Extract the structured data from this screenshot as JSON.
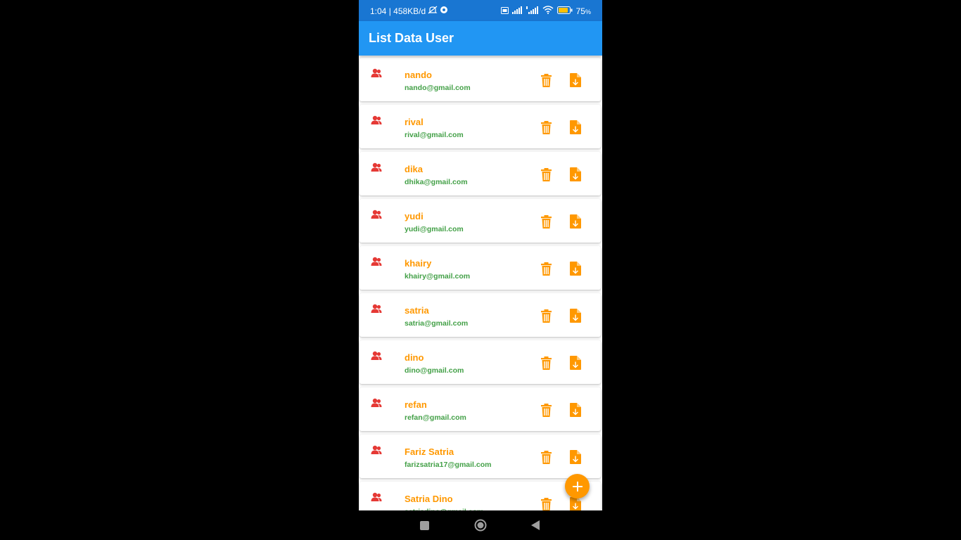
{
  "status_bar": {
    "time_speed": "1:04 | 458KB/d",
    "battery": "75",
    "battery_unit": "%",
    "icons": [
      "mute-icon",
      "settings-badge-icon",
      "volte-icon",
      "signal-icon",
      "signal-4g-icon",
      "wifi-icon",
      "battery-icon"
    ]
  },
  "app_bar": {
    "title": "List Data User",
    "color": "#2196f3"
  },
  "users": [
    {
      "name": "nando",
      "email": "nando@gmail.com"
    },
    {
      "name": "rival",
      "email": "rival@gmail.com"
    },
    {
      "name": "dika",
      "email": "dhika@gmail.com"
    },
    {
      "name": "yudi",
      "email": "yudi@gmail.com"
    },
    {
      "name": "khairy",
      "email": "khairy@gmail.com"
    },
    {
      "name": "satria",
      "email": "satria@gmail.com"
    },
    {
      "name": "dino",
      "email": "dino@gmail.com"
    },
    {
      "name": "refan",
      "email": "refan@gmail.com"
    },
    {
      "name": "Fariz Satria",
      "email": "farizsatria17@gmail.com"
    },
    {
      "name": "Satria Dino",
      "email": "satriadino@gmail.com"
    }
  ],
  "row_icons": {
    "leading": "person-icon",
    "actions": [
      "trash-icon",
      "file-download-icon"
    ]
  },
  "fab": {
    "icon": "plus-icon"
  },
  "nav_bar": {
    "icons": [
      "recents-icon",
      "home-icon",
      "back-icon"
    ]
  },
  "colors": {
    "status_bar": "#1976d2",
    "accent": "#ff9800",
    "email": "#43a047",
    "person_icon": "#e53935"
  }
}
